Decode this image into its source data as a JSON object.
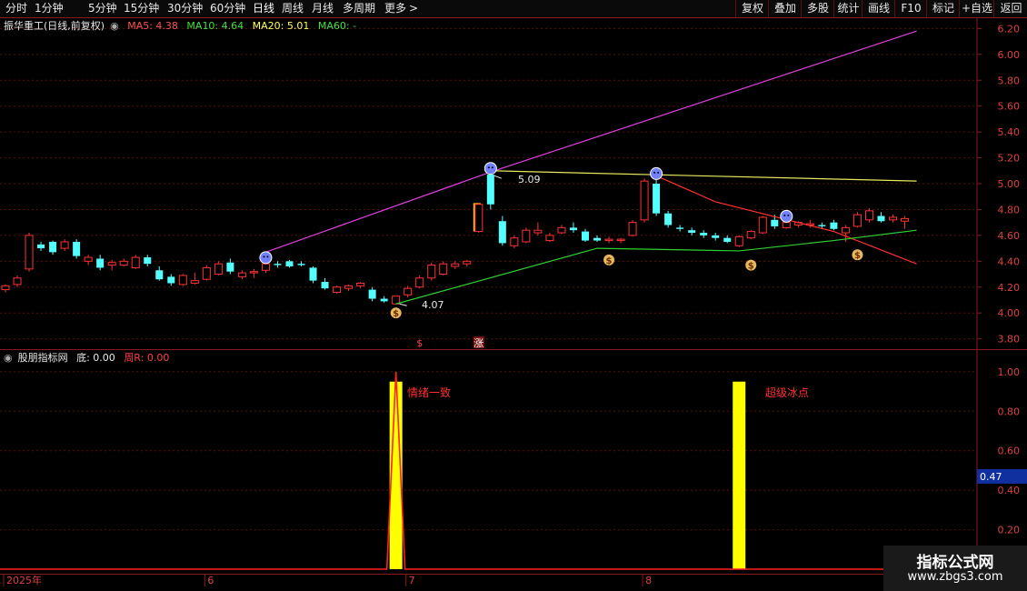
{
  "toolbar": {
    "items": [
      "分时",
      "1分钟",
      "5分钟",
      "15分钟",
      "30分钟",
      "60分钟",
      "日线",
      "周线",
      "月线",
      "多周期",
      "更多"
    ],
    "more_arrow": ">",
    "right_items": [
      "复权",
      "叠加",
      "多股",
      "统计",
      "画线",
      "F10",
      "+自选",
      "返回"
    ]
  },
  "main_legend": {
    "title": "振华重工(日线,前复权)",
    "ma5_label": "MA5: 4.38",
    "ma10_label": "MA10: 4.64",
    "ma20_label": "MA20: 5.01",
    "ma60_label": "MA60: -"
  },
  "sub_legend": {
    "title": "股朋指标网",
    "di_label": "底: 0.00",
    "zhou_label": "周R: 0.00"
  },
  "annotations": {
    "high_label": "5.09",
    "low_label": "4.07",
    "signal_1": "情绪一致",
    "signal_2": "超级冰点",
    "dollar_marker": "$",
    "rise_marker": "涨",
    "current_value": "0.47"
  },
  "watermark": {
    "name": "指标公式网",
    "url": "www.zbgs3.com"
  },
  "colors": {
    "up": "#ff3232",
    "down": "#54ffff",
    "ma_magenta": "#e040e0",
    "ma_yellow": "#e8e860",
    "ma_green": "#30d030",
    "ma_red": "#ff3030",
    "signal_bar": "#ffff00",
    "border": "#8a1a1a"
  },
  "chart_data": [
    {
      "type": "candlestick",
      "price_axis": [
        3.8,
        4.0,
        4.2,
        4.4,
        4.6,
        4.8,
        5.0,
        5.2,
        5.4,
        5.6,
        5.8,
        6.0,
        6.2
      ],
      "ylim": [
        3.72,
        6.28
      ],
      "x_labels": [
        "2025年",
        "6",
        "7",
        "8"
      ],
      "x_label_index": [
        0,
        17,
        34,
        54
      ],
      "candles": [
        [
          4.18,
          4.22,
          4.16,
          4.21
        ],
        [
          4.22,
          4.29,
          4.2,
          4.27
        ],
        [
          4.34,
          4.62,
          4.32,
          4.6
        ],
        [
          4.53,
          4.55,
          4.48,
          4.5
        ],
        [
          4.55,
          4.56,
          4.45,
          4.47
        ],
        [
          4.5,
          4.57,
          4.48,
          4.55
        ],
        [
          4.55,
          4.57,
          4.42,
          4.44
        ],
        [
          4.4,
          4.45,
          4.37,
          4.43
        ],
        [
          4.42,
          4.45,
          4.33,
          4.35
        ],
        [
          4.37,
          4.41,
          4.33,
          4.39
        ],
        [
          4.37,
          4.42,
          4.36,
          4.4
        ],
        [
          4.35,
          4.45,
          4.34,
          4.43
        ],
        [
          4.43,
          4.45,
          4.36,
          4.38
        ],
        [
          4.33,
          4.36,
          4.25,
          4.26
        ],
        [
          4.28,
          4.3,
          4.21,
          4.23
        ],
        [
          4.22,
          4.3,
          4.21,
          4.29
        ],
        [
          4.23,
          4.31,
          4.22,
          4.25
        ],
        [
          4.26,
          4.37,
          4.25,
          4.35
        ],
        [
          4.3,
          4.4,
          4.29,
          4.38
        ],
        [
          4.39,
          4.42,
          4.3,
          4.32
        ],
        [
          4.28,
          4.33,
          4.26,
          4.31
        ],
        [
          4.31,
          4.34,
          4.27,
          4.32
        ],
        [
          4.33,
          4.4,
          4.31,
          4.38
        ],
        [
          4.38,
          4.4,
          4.35,
          4.37
        ],
        [
          4.4,
          4.41,
          4.35,
          4.36
        ],
        [
          4.38,
          4.4,
          4.36,
          4.37
        ],
        [
          4.35,
          4.36,
          4.23,
          4.25
        ],
        [
          4.24,
          4.27,
          4.18,
          4.19
        ],
        [
          4.16,
          4.21,
          4.15,
          4.2
        ],
        [
          4.19,
          4.22,
          4.17,
          4.21
        ],
        [
          4.21,
          4.24,
          4.19,
          4.23
        ],
        [
          4.18,
          4.2,
          4.09,
          4.11
        ],
        [
          4.11,
          4.13,
          4.08,
          4.09
        ],
        [
          4.07,
          4.13,
          4.07,
          4.13
        ],
        [
          4.14,
          4.21,
          4.12,
          4.19
        ],
        [
          4.2,
          4.29,
          4.19,
          4.27
        ],
        [
          4.27,
          4.39,
          4.25,
          4.37
        ],
        [
          4.3,
          4.4,
          4.29,
          4.38
        ],
        [
          4.36,
          4.4,
          4.34,
          4.38
        ],
        [
          4.38,
          4.41,
          4.36,
          4.4
        ],
        [
          4.63,
          4.85,
          4.62,
          4.84
        ],
        [
          5.07,
          5.09,
          4.8,
          4.84
        ],
        [
          4.71,
          4.75,
          4.52,
          4.54
        ],
        [
          4.52,
          4.6,
          4.5,
          4.58
        ],
        [
          4.55,
          4.66,
          4.54,
          4.64
        ],
        [
          4.62,
          4.7,
          4.6,
          4.64
        ],
        [
          4.56,
          4.62,
          4.55,
          4.6
        ],
        [
          4.62,
          4.68,
          4.61,
          4.66
        ],
        [
          4.66,
          4.7,
          4.62,
          4.64
        ],
        [
          4.63,
          4.65,
          4.55,
          4.56
        ],
        [
          4.58,
          4.6,
          4.55,
          4.56
        ],
        [
          4.56,
          4.59,
          4.54,
          4.57
        ],
        [
          4.56,
          4.58,
          4.54,
          4.57
        ],
        [
          4.6,
          4.72,
          4.59,
          4.7
        ],
        [
          4.72,
          5.04,
          4.7,
          5.02
        ],
        [
          5.0,
          5.05,
          4.75,
          4.77
        ],
        [
          4.77,
          4.79,
          4.66,
          4.68
        ],
        [
          4.66,
          4.68,
          4.63,
          4.65
        ],
        [
          4.64,
          4.66,
          4.6,
          4.62
        ],
        [
          4.62,
          4.64,
          4.58,
          4.6
        ],
        [
          4.6,
          4.62,
          4.56,
          4.58
        ],
        [
          4.58,
          4.6,
          4.54,
          4.55
        ],
        [
          4.52,
          4.6,
          4.51,
          4.59
        ],
        [
          4.58,
          4.64,
          4.57,
          4.63
        ],
        [
          4.62,
          4.75,
          4.61,
          4.74
        ],
        [
          4.72,
          4.76,
          4.65,
          4.67
        ],
        [
          4.66,
          4.72,
          4.65,
          4.7
        ],
        [
          4.68,
          4.71,
          4.66,
          4.7
        ],
        [
          4.68,
          4.72,
          4.66,
          4.69
        ],
        [
          4.68,
          4.7,
          4.65,
          4.67
        ],
        [
          4.7,
          4.72,
          4.64,
          4.65
        ],
        [
          4.62,
          4.68,
          4.55,
          4.66
        ],
        [
          4.67,
          4.78,
          4.66,
          4.76
        ],
        [
          4.72,
          4.81,
          4.7,
          4.79
        ],
        [
          4.75,
          4.78,
          4.7,
          4.71
        ],
        [
          4.72,
          4.76,
          4.7,
          4.74
        ],
        [
          4.71,
          4.75,
          4.65,
          4.73
        ]
      ],
      "lines": [
        {
          "color": "#e040e0",
          "points": [
            [
              22,
              4.47
            ],
            [
              41,
              5.09
            ],
            [
              77,
              6.18
            ]
          ]
        },
        {
          "color": "#e8e860",
          "points": [
            [
              41,
              5.1
            ],
            [
              77,
              5.02
            ]
          ]
        },
        {
          "color": "#ff3030",
          "points": [
            [
              55,
              5.06
            ],
            [
              60,
              4.86
            ],
            [
              70,
              4.63
            ],
            [
              77,
              4.38
            ]
          ]
        },
        {
          "color": "#30d030",
          "points": [
            [
              33,
              4.07
            ],
            [
              50,
              4.5
            ],
            [
              62,
              4.48
            ],
            [
              70,
              4.56
            ],
            [
              77,
              4.64
            ]
          ]
        }
      ],
      "face_markers": [
        22,
        41,
        55,
        66
      ],
      "money_markers": [
        [
          33,
          4.0
        ],
        [
          51,
          4.41
        ],
        [
          63,
          4.37
        ],
        [
          72,
          4.45
        ]
      ],
      "bottom_markers": [
        [
          35,
          "$"
        ],
        [
          40,
          "涨"
        ]
      ],
      "highlight_bar": {
        "index": 40,
        "low": 4.63,
        "high": 4.85
      }
    },
    {
      "type": "bar",
      "ylim": [
        0,
        1.05
      ],
      "ticks": [
        0.2,
        0.4,
        0.6,
        0.8,
        1.0
      ],
      "bars": [
        {
          "index": 33,
          "value": 0.95
        },
        {
          "index": 62,
          "value": 0.95
        }
      ],
      "spike": {
        "index": 33,
        "value": 1.0
      },
      "current_value": 0.47
    }
  ]
}
